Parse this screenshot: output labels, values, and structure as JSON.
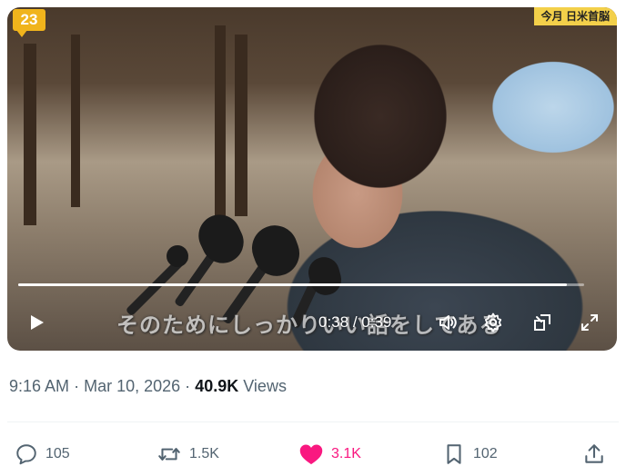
{
  "video": {
    "channel_logo": "23",
    "ticker_text": "今月 日米首脳",
    "caption": "そのためにしっかりいい話をしてある",
    "current_time": "0:38",
    "duration": "0:39",
    "progress_fraction": 0.97,
    "icons": {
      "play": "play-icon",
      "volume": "volume-icon",
      "settings": "gear-icon",
      "popout": "picture-in-picture-icon",
      "fullscreen": "fullscreen-icon"
    }
  },
  "tweet": {
    "time": "9:16 AM",
    "date": "Mar 10, 2026",
    "views_count": "40.9K",
    "views_label": "Views",
    "sep": "·"
  },
  "actions": {
    "replies": "105",
    "reposts": "1.5K",
    "likes": "3.1K",
    "bookmarks": "102"
  },
  "colors": {
    "like_active": "#f91880",
    "muted_text": "#536471",
    "primary_text": "#0f1419"
  }
}
